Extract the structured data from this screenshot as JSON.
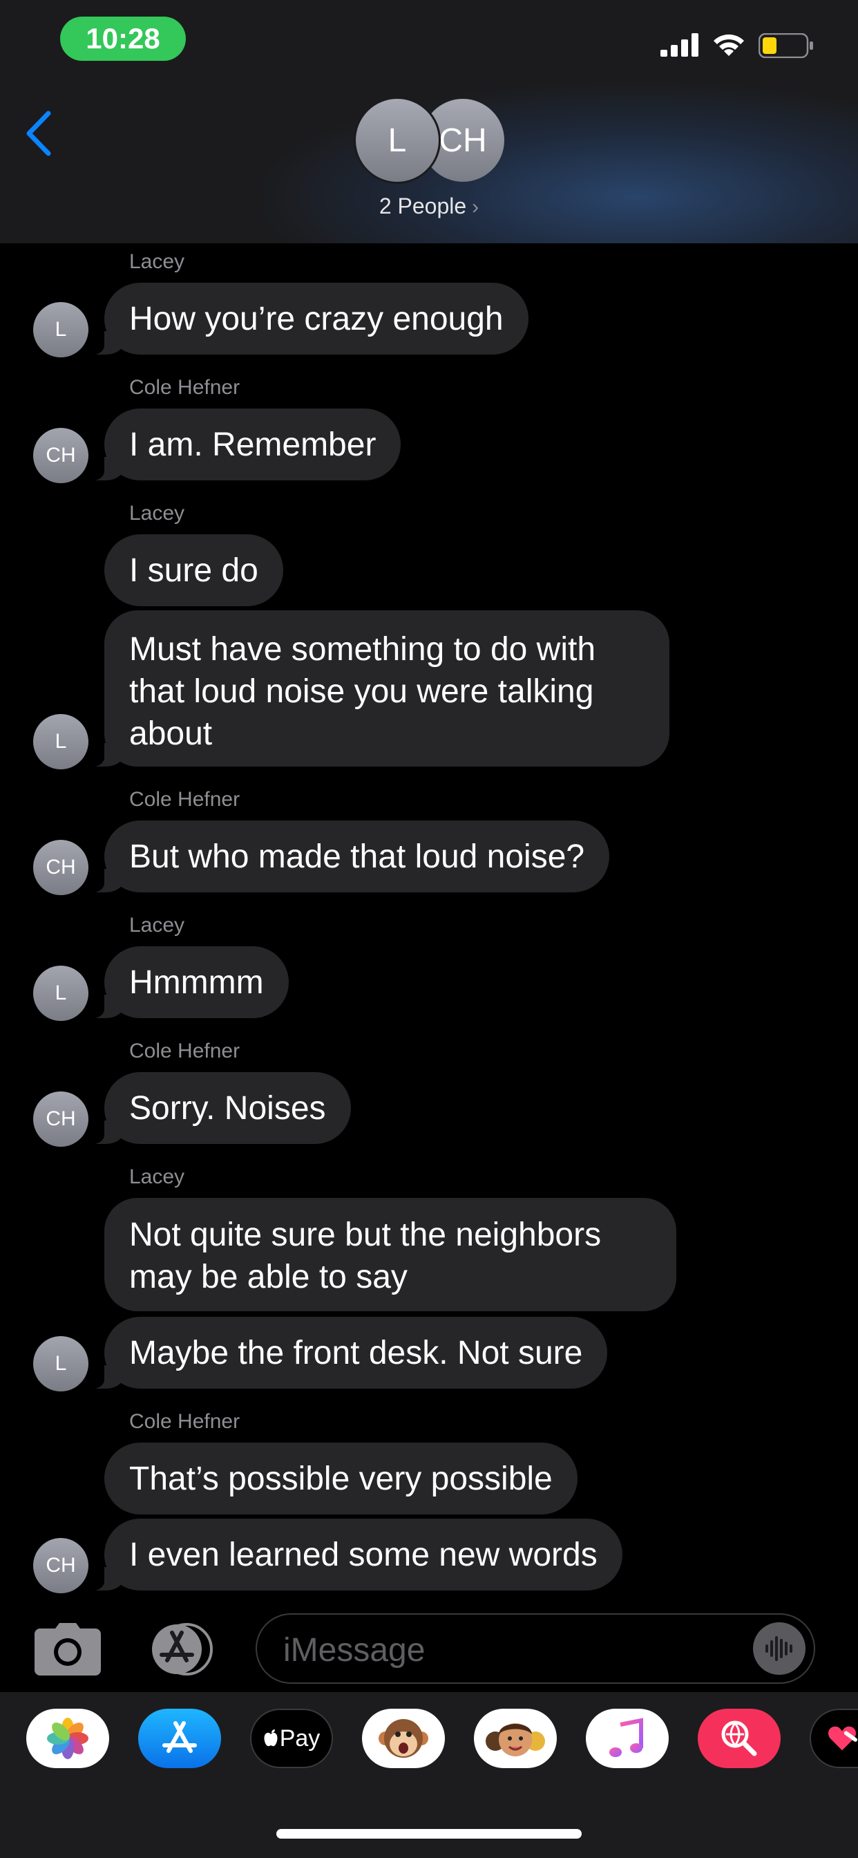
{
  "status_bar": {
    "time": "10:28"
  },
  "header": {
    "avatars": [
      "L",
      "CH"
    ],
    "people_link": "2 People"
  },
  "messages": [
    {
      "sender": "Lacey",
      "text": "How you’re crazy enough",
      "avatar": "L"
    },
    {
      "sender": "Cole Hefner",
      "text": "I am. Remember",
      "avatar": "CH"
    },
    {
      "sender": "Lacey",
      "text": "I sure do"
    },
    {
      "text": "Must have something to do with that loud noise you were talking about",
      "avatar": "L"
    },
    {
      "sender": "Cole Hefner",
      "text": "But who made that loud noise?",
      "avatar": "CH"
    },
    {
      "sender": "Lacey",
      "text": "Hmmmm",
      "avatar": "L"
    },
    {
      "sender": "Cole Hefner",
      "text": "Sorry. Noises",
      "avatar": "CH"
    },
    {
      "sender": "Lacey",
      "text": "Not quite sure but the neighbors may be able to say"
    },
    {
      "text": "Maybe the front desk. Not sure",
      "avatar": "L"
    },
    {
      "sender": "Cole Hefner",
      "text": "That’s possible very possible"
    },
    {
      "text": "I even learned some new words",
      "avatar": "CH"
    }
  ],
  "input": {
    "placeholder": "iMessage"
  },
  "app_drawer": {
    "apps": [
      "photos-icon",
      "app-store-icon",
      "apple-pay-icon",
      "animoji-icon",
      "memoji-icon",
      "music-icon",
      "web-search-icon",
      "digital-touch-icon"
    ],
    "apple_pay_label": "Pay"
  },
  "colors": {
    "status_green": "#34c759",
    "ios_blue": "#0a84ff",
    "bubble_gray": "#262628",
    "sender_gray": "#8e8e93",
    "battery_yellow": "#ffd60a"
  }
}
